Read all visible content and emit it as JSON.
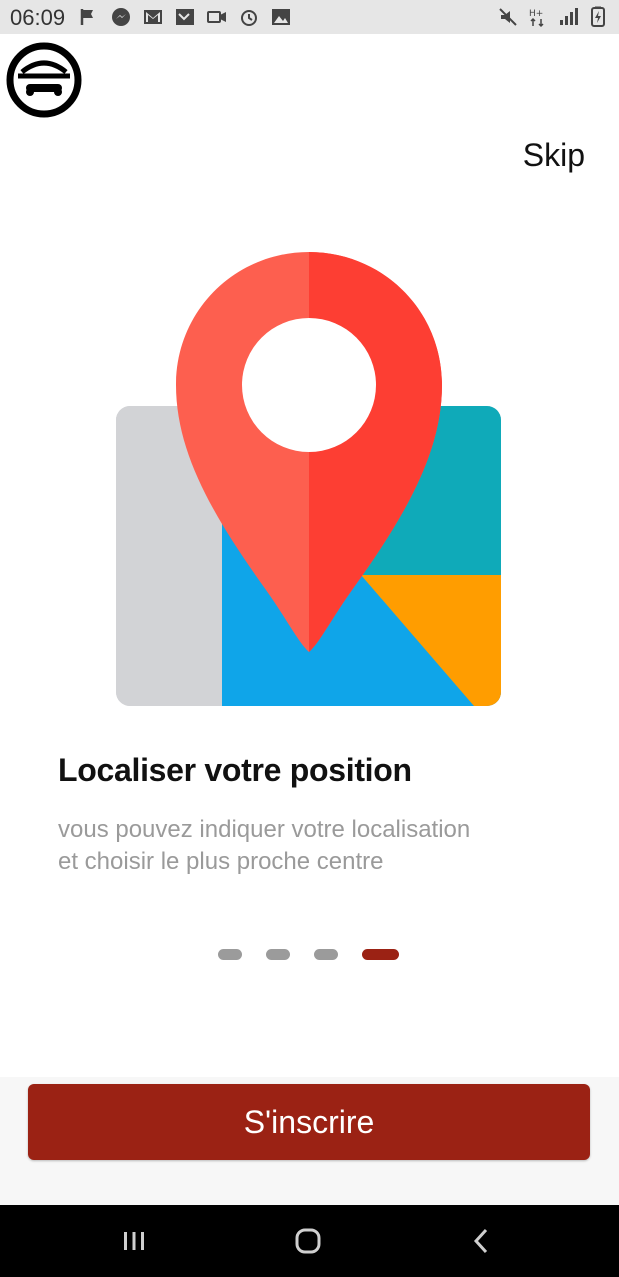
{
  "status_bar": {
    "time": "06:09",
    "left_icons": [
      "flag-icon",
      "messenger-icon",
      "gmail-icon",
      "missed-call-icon",
      "video-icon",
      "alarm-icon",
      "gallery-icon"
    ],
    "right_icons": [
      "mute-icon",
      "network-hplus-icon",
      "signal-icon",
      "battery-icon"
    ]
  },
  "header": {
    "logo_icon": "app-logo-icon",
    "skip_label": "Skip"
  },
  "onboarding": {
    "illustration": "map-pin-illustration",
    "title": "Localiser votre position",
    "description_line1": "vous pouvez indiquer votre localisation",
    "description_line2": "et choisir le plus proche centre",
    "page_count": 4,
    "active_page": 4
  },
  "actions": {
    "signup_label": "S'inscrire"
  },
  "navigation": {
    "buttons": [
      "recents-icon",
      "home-icon",
      "back-icon"
    ]
  },
  "colors": {
    "accent": "#9b2214",
    "dot_inactive": "#9b9b9b",
    "pin_left": "#fd5f4f",
    "pin_right": "#fd3e33",
    "map_gray": "#d2d3d6",
    "map_teal": "#0faab9",
    "map_blue": "#0fa5e9",
    "map_orange": "#ff9d00"
  }
}
